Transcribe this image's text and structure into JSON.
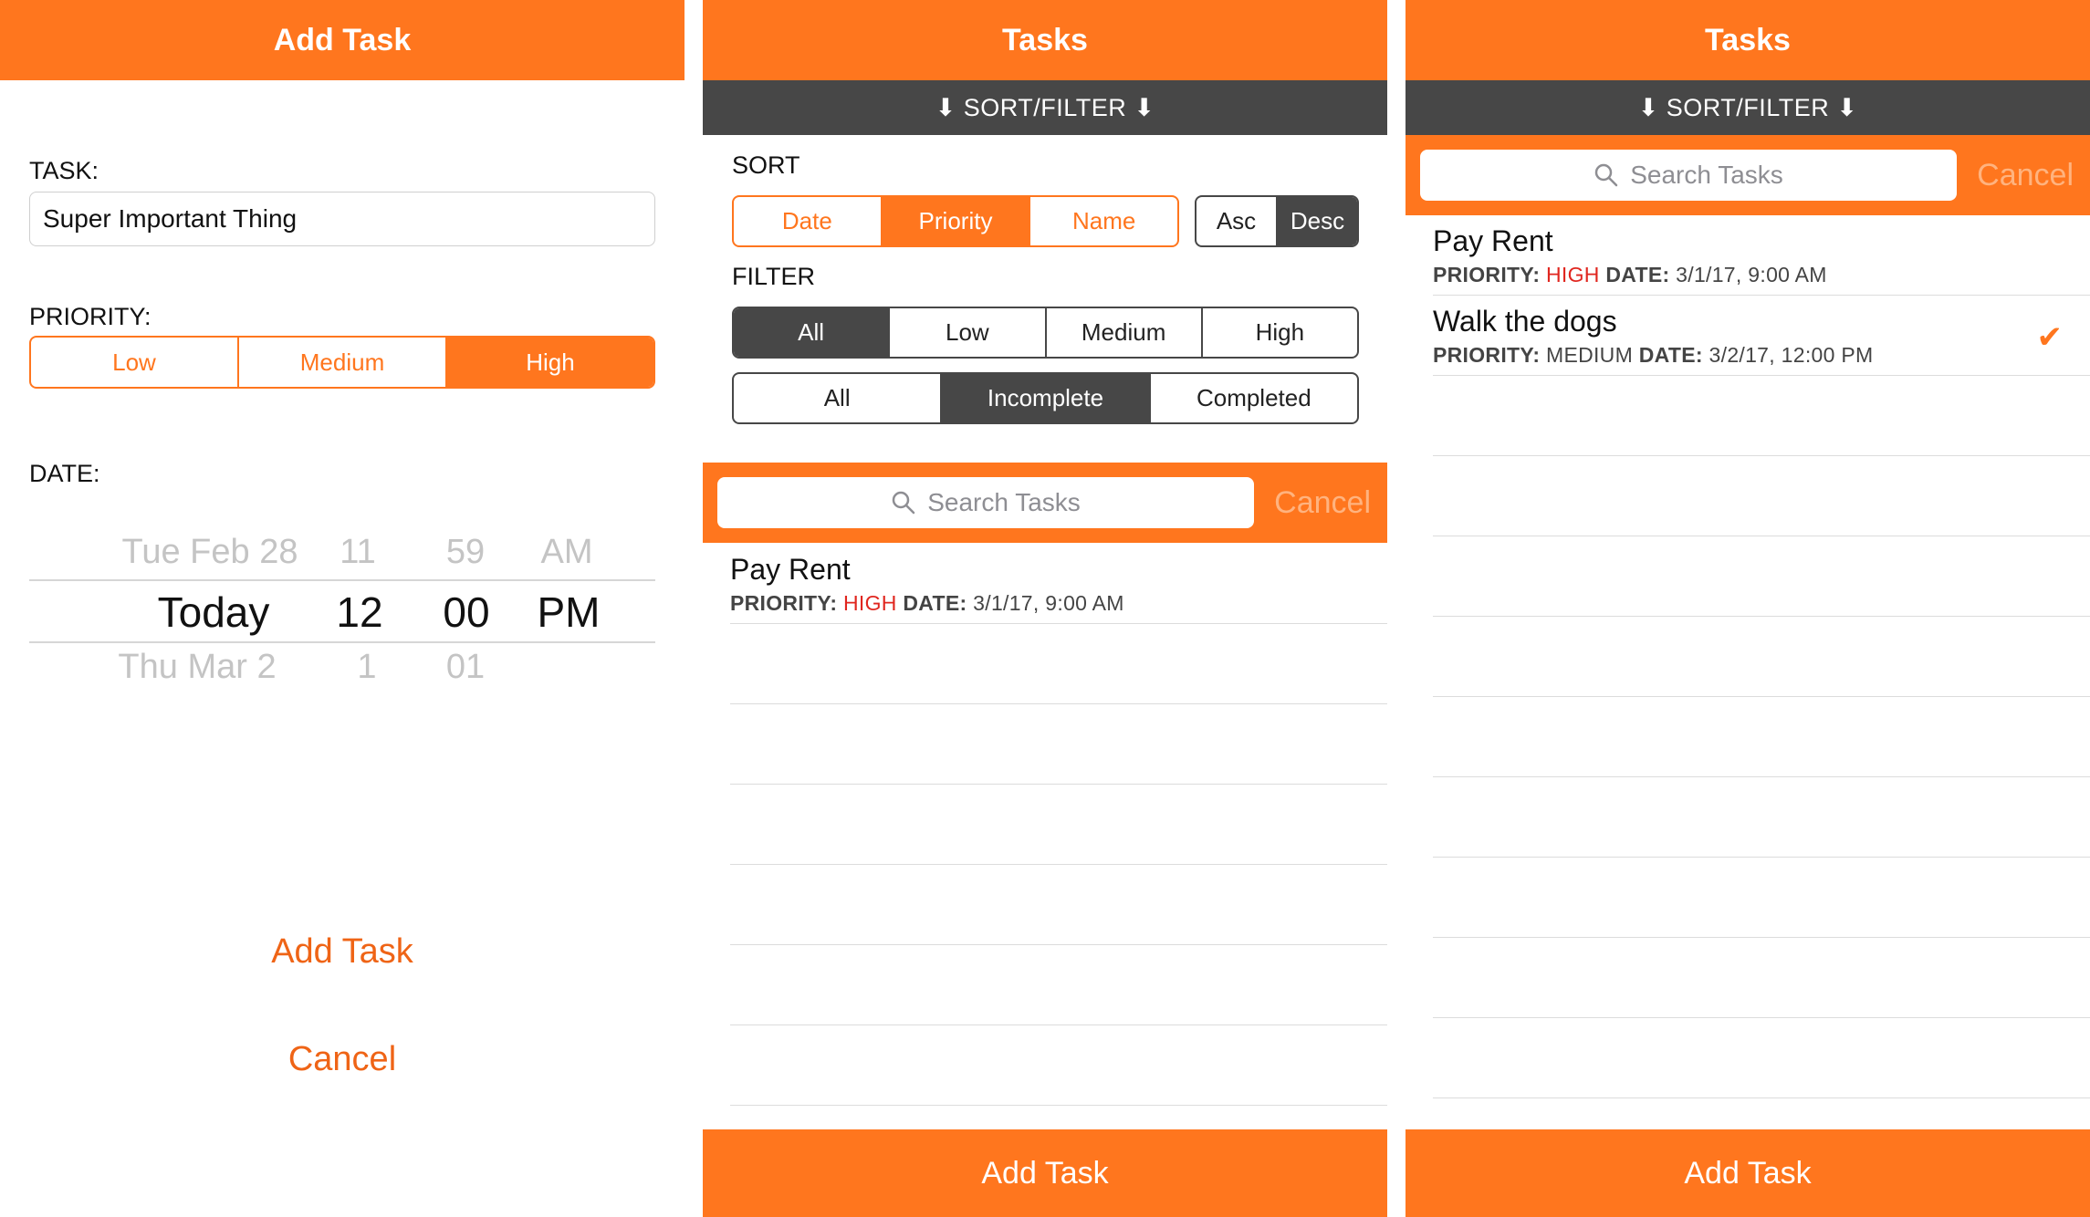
{
  "colors": {
    "accent": "#ff761e",
    "dark": "#474747",
    "high": "#e0261f"
  },
  "add_screen": {
    "title": "Add Task",
    "task_label": "TASK:",
    "task_value": "Super Important Thing",
    "priority_label": "PRIORITY:",
    "priority_options": [
      "Low",
      "Medium",
      "High"
    ],
    "priority_selected": "High",
    "date_label": "DATE:",
    "picker": {
      "prev": {
        "day": "Tue Feb 28",
        "hour": "11",
        "minute": "59",
        "ampm": "AM"
      },
      "current": {
        "day": "Today",
        "hour": "12",
        "minute": "00",
        "ampm": "PM"
      },
      "next": {
        "day": "Thu Mar 2",
        "hour": "1",
        "minute": "01",
        "ampm": ""
      }
    },
    "add_button": "Add Task",
    "cancel_button": "Cancel"
  },
  "list_screen_filter": {
    "title": "Tasks",
    "sort_filter_label": "⬇ SORT/FILTER ⬇",
    "sort_label": "SORT",
    "sort_options": [
      "Date",
      "Priority",
      "Name"
    ],
    "sort_selected": "Priority",
    "order_options": [
      "Asc",
      "Desc"
    ],
    "order_selected": "Desc",
    "filter_label": "FILTER",
    "priority_filter_options": [
      "All",
      "Low",
      "Medium",
      "High"
    ],
    "priority_filter_selected": "All",
    "status_filter_options": [
      "All",
      "Incomplete",
      "Completed"
    ],
    "status_filter_selected": "Incomplete",
    "search_placeholder": "Search Tasks",
    "search_cancel": "Cancel",
    "tasks": [
      {
        "name": "Pay Rent",
        "priority_label": "PRIORITY:",
        "priority": "HIGH",
        "date_label": "DATE:",
        "date": "3/1/17, 9:00 AM",
        "completed": false
      }
    ],
    "add_button": "Add Task"
  },
  "list_screen_all": {
    "title": "Tasks",
    "sort_filter_label": "⬇ SORT/FILTER ⬇",
    "search_placeholder": "Search Tasks",
    "search_cancel": "Cancel",
    "tasks": [
      {
        "name": "Pay Rent",
        "priority_label": "PRIORITY:",
        "priority": "HIGH",
        "date_label": "DATE:",
        "date": "3/1/17, 9:00 AM",
        "completed": false
      },
      {
        "name": "Walk the dogs",
        "priority_label": "PRIORITY:",
        "priority": "MEDIUM",
        "date_label": "DATE:",
        "date": "3/2/17, 12:00 PM",
        "completed": true
      }
    ],
    "add_button": "Add Task"
  }
}
